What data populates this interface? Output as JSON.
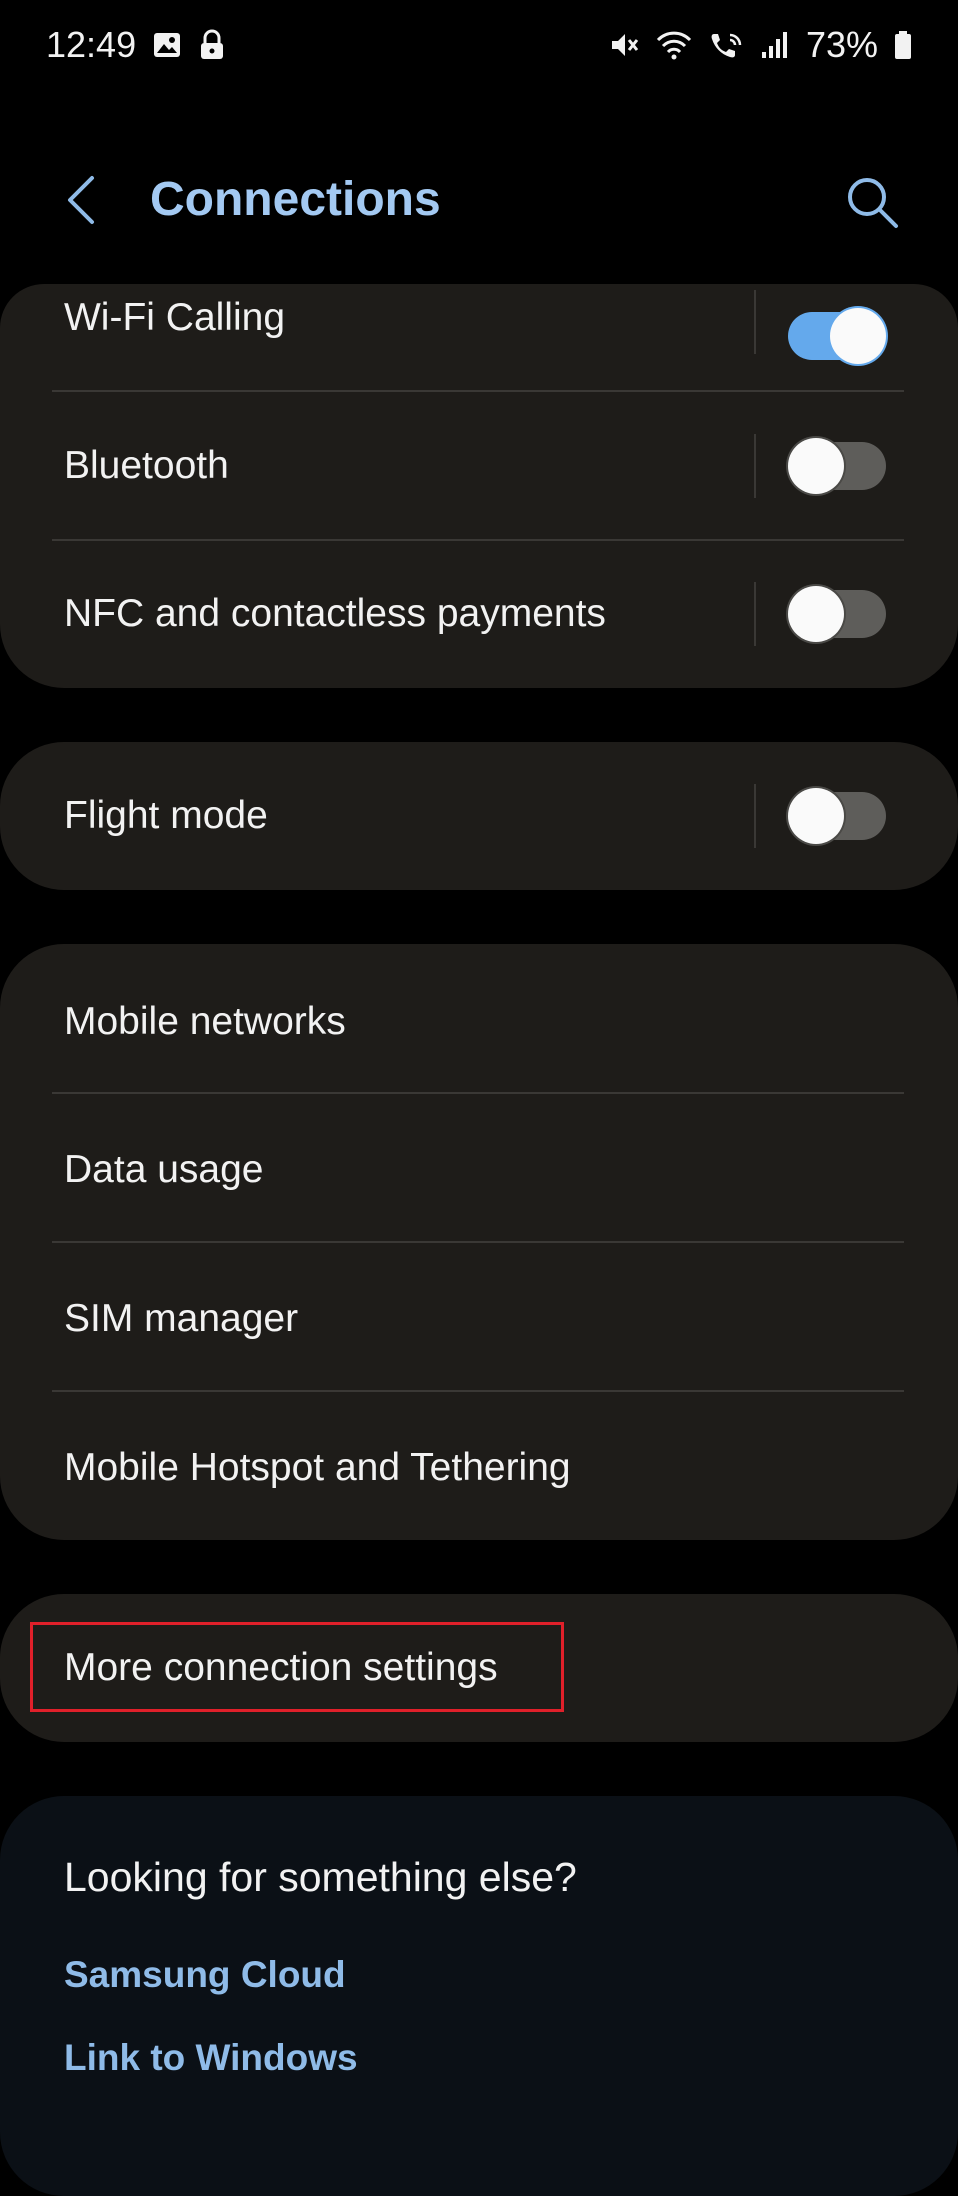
{
  "status_bar": {
    "time": "12:49",
    "battery": "73%",
    "left_icons": [
      "gallery-icon",
      "lock-icon"
    ],
    "right_icons": [
      "mute-icon",
      "wifi-icon",
      "wifi-calling-icon",
      "signal-icon",
      "battery-icon"
    ]
  },
  "header": {
    "title": "Connections",
    "back_icon": "chevron-left-icon",
    "search_icon": "search-icon"
  },
  "colors": {
    "accent": "#a3c9f2",
    "toggle_on": "#64a9ec",
    "card_bg": "#1e1c19",
    "highlight": "#e0202a"
  },
  "group_toggles": {
    "items": [
      {
        "label": "Wi-Fi Calling",
        "enabled": true
      },
      {
        "label": "Bluetooth",
        "enabled": false
      },
      {
        "label": "NFC and contactless payments",
        "enabled": false
      }
    ]
  },
  "flight_mode": {
    "label": "Flight mode",
    "enabled": false
  },
  "group_networks": {
    "items": [
      {
        "label": "Mobile networks"
      },
      {
        "label": "Data usage"
      },
      {
        "label": "SIM manager"
      },
      {
        "label": "Mobile Hotspot and Tethering"
      }
    ]
  },
  "more_settings": {
    "label": "More connection settings",
    "highlighted": true
  },
  "suggestions": {
    "title": "Looking for something else?",
    "links": [
      {
        "label": "Samsung Cloud"
      },
      {
        "label": "Link to Windows"
      }
    ]
  }
}
